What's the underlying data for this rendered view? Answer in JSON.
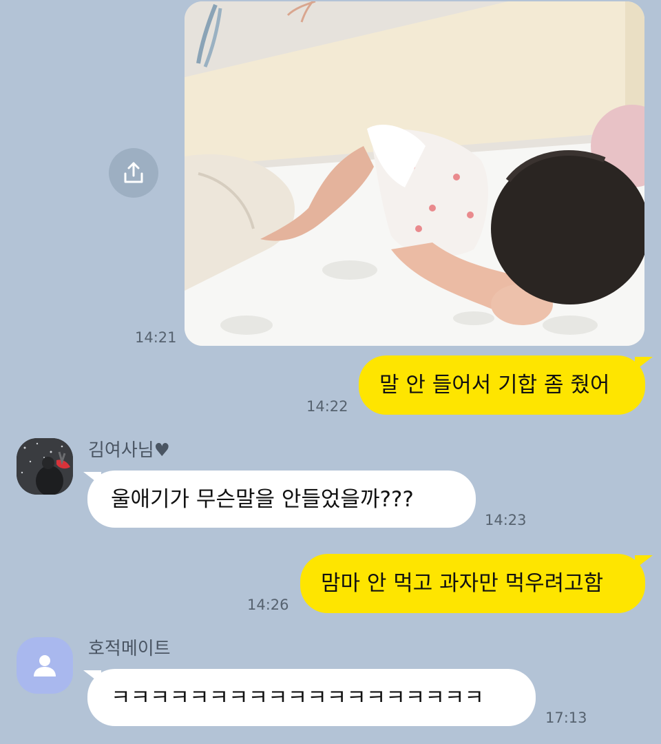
{
  "messages": {
    "photo": {
      "time": "14:21",
      "share_icon": "share-upload-icon"
    },
    "out1": {
      "text": "말 안 들어서 기합 좀 줬어",
      "time": "14:22"
    },
    "in1": {
      "sender": "김여사님♥",
      "text": "울애기가  무슨말을  안들었을까???",
      "time": "14:23"
    },
    "out2": {
      "text": "맘마 안 먹고 과자만 먹우려고함",
      "time": "14:26"
    },
    "in2": {
      "sender": "호적메이트",
      "text": "ㅋㅋㅋㅋㅋㅋㅋㅋㅋㅋㅋㅋㅋㅋㅋㅋㅋㅋㅋ",
      "time": "17:13"
    }
  },
  "colors": {
    "background": "#b3c3d6",
    "outgoing_bubble": "#fee500",
    "incoming_bubble": "#ffffff",
    "default_avatar": "#a9b8ee"
  }
}
